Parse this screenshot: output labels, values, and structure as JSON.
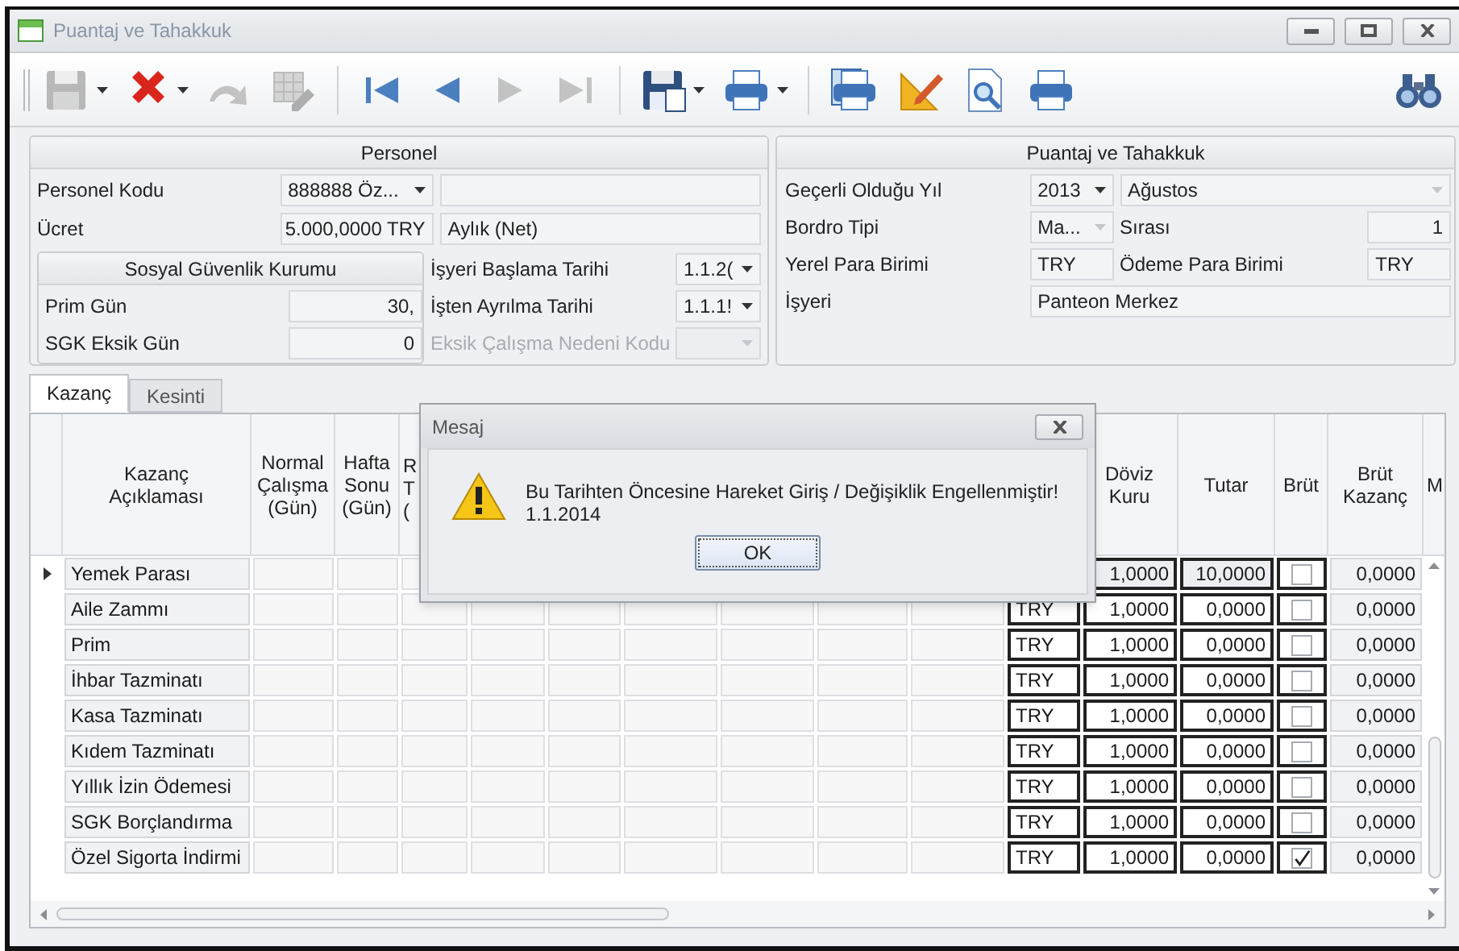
{
  "window": {
    "title": "Puantaj ve Tahakkuk"
  },
  "toolbar": [
    {
      "kind": "save",
      "disabled": true,
      "dropdown": true
    },
    {
      "kind": "delete",
      "disabled": false,
      "dropdown": true
    },
    {
      "kind": "redo",
      "disabled": true,
      "dropdown": false
    },
    {
      "kind": "table-edit",
      "disabled": true,
      "dropdown": false
    },
    {
      "kind": "separator"
    },
    {
      "kind": "first",
      "disabled": false,
      "dropdown": false
    },
    {
      "kind": "previous",
      "disabled": false,
      "dropdown": false
    },
    {
      "kind": "next",
      "disabled": true,
      "dropdown": false
    },
    {
      "kind": "last",
      "disabled": true,
      "dropdown": false
    },
    {
      "kind": "separator"
    },
    {
      "kind": "save-as",
      "disabled": false,
      "dropdown": true
    },
    {
      "kind": "print",
      "disabled": false,
      "dropdown": true
    },
    {
      "kind": "separator"
    },
    {
      "kind": "print-setup",
      "disabled": false,
      "dropdown": false
    },
    {
      "kind": "design",
      "disabled": false,
      "dropdown": false
    },
    {
      "kind": "preview",
      "disabled": false,
      "dropdown": false
    },
    {
      "kind": "print",
      "disabled": false,
      "dropdown": false
    },
    {
      "kind": "spacer"
    },
    {
      "kind": "find",
      "disabled": false,
      "dropdown": false
    }
  ],
  "personel": {
    "title": "Personel",
    "code": {
      "label": "Personel Kodu",
      "value": "888888 Öz..."
    },
    "wage": {
      "label": "Ücret",
      "value": "5.000,0000 TRY",
      "period": "Aylık (Net)"
    },
    "sgk": {
      "title": "Sosyal Güvenlik Kurumu",
      "premium_days": {
        "label": "Prim Gün",
        "value": "30,"
      },
      "missing_days": {
        "label": "SGK Eksik Gün",
        "value": "0"
      }
    },
    "start_date": {
      "label": "İşyeri Başlama Tarihi",
      "value": "1.1.2("
    },
    "end_date": {
      "label": "İşten Ayrılma Tarihi",
      "value": "1.1.1!"
    },
    "missing_reason": {
      "label": "Eksik Çalışma Nedeni Kodu",
      "disabled": true
    }
  },
  "accrual": {
    "title": "Puantaj ve Tahakkuk",
    "year": {
      "label": "Geçerli Olduğu Yıl",
      "value": "2013",
      "month": "Ağustos"
    },
    "payroll_type": {
      "label": "Bordro Tipi",
      "value": "Ma...",
      "order_label": "Sırası",
      "order": "1"
    },
    "local_currency": {
      "label": "Yerel Para Birimi",
      "value": "TRY",
      "payment_label": "Ödeme Para Birimi",
      "payment": "TRY"
    },
    "workplace": {
      "label": "İşyeri",
      "value": "Panteon Merkez"
    }
  },
  "tabs": [
    {
      "label": "Kazanç",
      "selected": true
    },
    {
      "label": "Kesinti",
      "selected": false
    }
  ],
  "grid": {
    "columns": [
      "Kazanç\nAçıklaması",
      "Normal\nÇalışma\n(Gün)",
      "Hafta\nSonu\n(Gün)",
      "R\nT\n(",
      "Döviz\nKuru",
      "Tutar",
      "Brüt",
      "Brüt\nKazanç",
      "M"
    ],
    "rows": [
      {
        "name": "Yemek Parası",
        "selected": true,
        "rate": "1,0000",
        "amount": "10,0000",
        "gross": false,
        "gross_amount": "0,0000"
      },
      {
        "name": "Aile Zammı",
        "selected": false,
        "currency": "TRY",
        "rate": "1,0000",
        "amount": "0,0000",
        "gross": false,
        "gross_amount": "0,0000"
      },
      {
        "name": "Prim",
        "selected": false,
        "currency": "TRY",
        "rate": "1,0000",
        "amount": "0,0000",
        "gross": false,
        "gross_amount": "0,0000"
      },
      {
        "name": "İhbar Tazminatı",
        "selected": false,
        "currency": "TRY",
        "rate": "1,0000",
        "amount": "0,0000",
        "gross": false,
        "gross_amount": "0,0000"
      },
      {
        "name": "Kasa Tazminatı",
        "selected": false,
        "currency": "TRY",
        "rate": "1,0000",
        "amount": "0,0000",
        "gross": false,
        "gross_amount": "0,0000"
      },
      {
        "name": "Kıdem Tazminatı",
        "selected": false,
        "currency": "TRY",
        "rate": "1,0000",
        "amount": "0,0000",
        "gross": false,
        "gross_amount": "0,0000"
      },
      {
        "name": "Yıllık İzin Ödemesi",
        "selected": false,
        "currency": "TRY",
        "rate": "1,0000",
        "amount": "0,0000",
        "gross": false,
        "gross_amount": "0,0000"
      },
      {
        "name": "SGK Borçlandırma",
        "selected": false,
        "currency": "TRY",
        "rate": "1,0000",
        "amount": "0,0000",
        "gross": false,
        "gross_amount": "0,0000"
      },
      {
        "name": "Özel Sigorta İndirmi",
        "selected": false,
        "currency": "TRY",
        "rate": "1,0000",
        "amount": "0,0000",
        "gross": true,
        "gross_amount": "0,0000"
      }
    ]
  },
  "dialog": {
    "title": "Mesaj",
    "message": "Bu Tarihten Öncesine Hareket Giriş / Değişiklik Engellenmiştir!",
    "detail": "1.1.2014",
    "button": "OK"
  }
}
